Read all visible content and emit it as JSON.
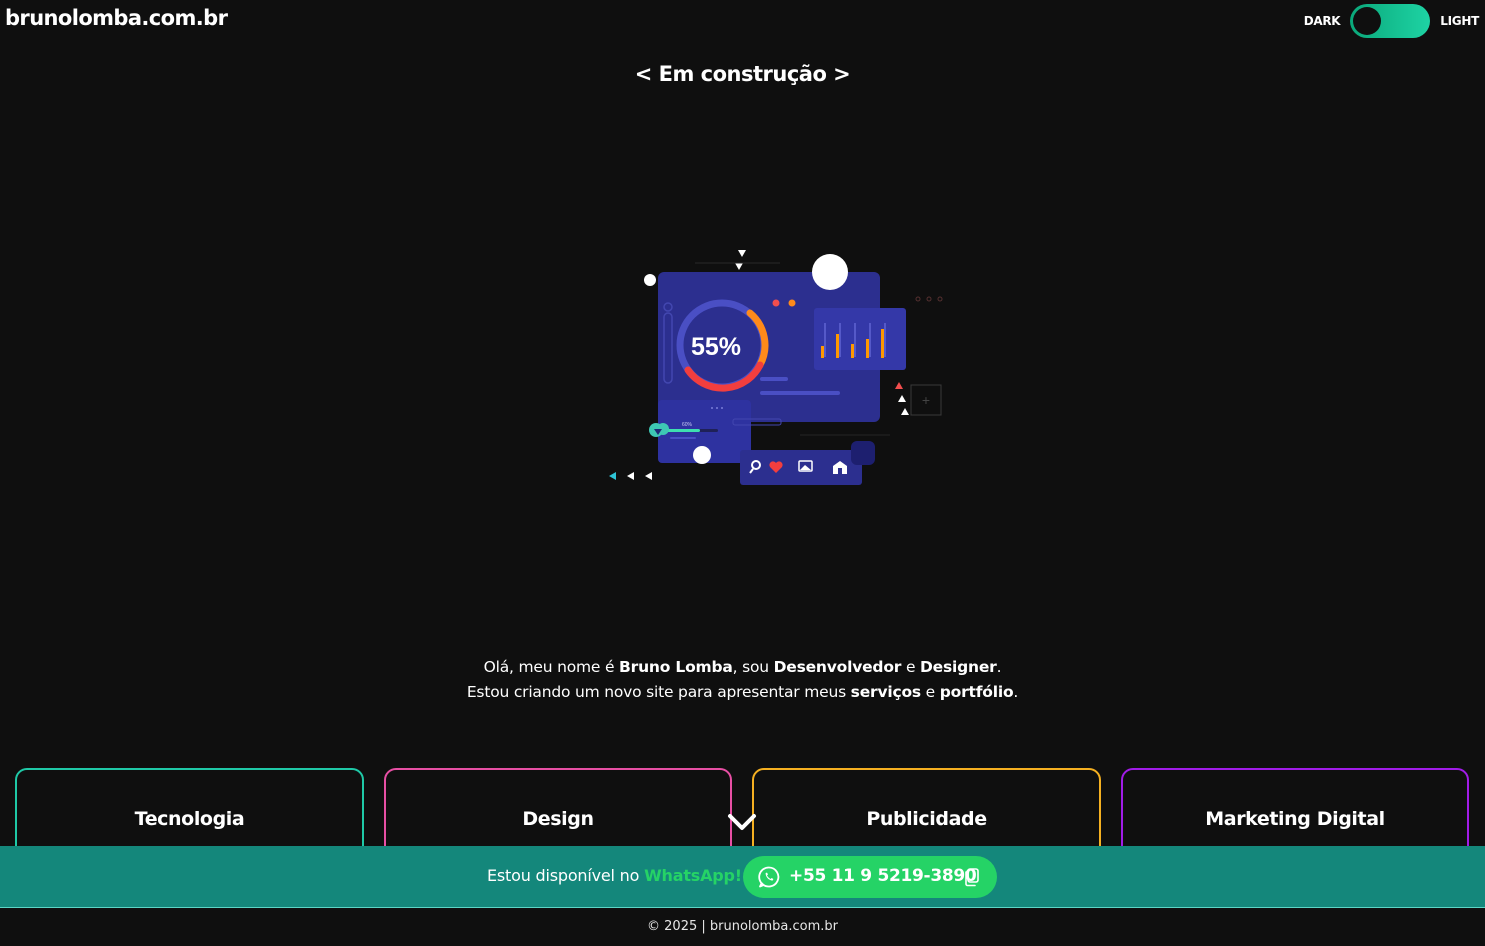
{
  "header": {
    "logo": "brunolomba.com.br",
    "theme_toggle": {
      "dark_label": "DARK",
      "light_label": "LIGHT",
      "state": "dark"
    }
  },
  "main": {
    "title": "< Em construção >",
    "illustration": {
      "percent_label": "55%",
      "small_percent": "60%"
    },
    "intro": {
      "line1": {
        "pre": "Olá, meu nome é ",
        "name": "Bruno Lomba",
        "mid": ", sou ",
        "role1": "Desenvolvedor",
        "and": " e ",
        "role2": "Designer",
        "end": "."
      },
      "line2": {
        "pre": "Estou criando um novo site para apresentar meus ",
        "services": "serviços",
        "and": " e ",
        "portfolio": "portfólio",
        "end": "."
      }
    },
    "cards": [
      {
        "label": "Tecnologia",
        "color": "#1fc9a7"
      },
      {
        "label": "Design",
        "color": "#e74fa4"
      },
      {
        "label": "Publicidade",
        "color": "#f5b021"
      },
      {
        "label": "Marketing Digital",
        "color": "#a11ce8"
      }
    ]
  },
  "whatsapp": {
    "text": "Estou disponível no ",
    "highlight": "WhatsApp!",
    "number": "+55 11 9 5219-3890",
    "bar_color": "#14877b",
    "button_color": "#25d366"
  },
  "footer": {
    "text": "© 2025 | brunolomba.com.br"
  }
}
